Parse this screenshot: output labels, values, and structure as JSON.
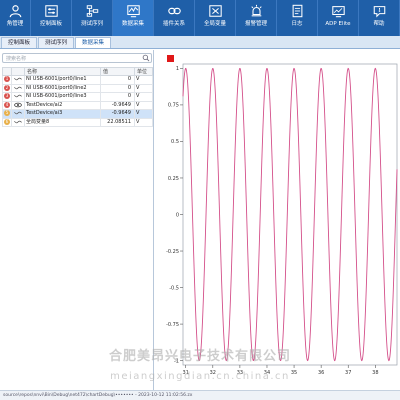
{
  "toolbar": {
    "items": [
      {
        "label": "角管理",
        "icon": "person-icon"
      },
      {
        "label": "控制面板",
        "icon": "control-panel-icon"
      },
      {
        "label": "测试序列",
        "icon": "sequence-icon"
      },
      {
        "label": "数据采集",
        "icon": "data-acquisition-icon"
      },
      {
        "label": "插件关系",
        "icon": "link-icon"
      },
      {
        "label": "全局变量",
        "icon": "global-variable-icon"
      },
      {
        "label": "报警管理",
        "icon": "alarm-icon"
      },
      {
        "label": "日志",
        "icon": "log-icon"
      },
      {
        "label": "ADP Elite",
        "icon": "adp-elite-icon"
      },
      {
        "label": "帮助",
        "icon": "help-icon"
      }
    ],
    "active_index": 3
  },
  "tabs": [
    {
      "label": "控制面板"
    },
    {
      "label": "测试序列"
    },
    {
      "label": "数据采集"
    }
  ],
  "active_tab": 2,
  "search": {
    "placeholder": "搜索名称"
  },
  "table": {
    "headers": [
      "名称",
      "值",
      "单位"
    ],
    "rows": [
      {
        "index": "1",
        "index_color": "#d9534f",
        "type": "wave",
        "name": "NI USB-6001/port0/line1",
        "value": "0",
        "unit": "V"
      },
      {
        "index": "2",
        "index_color": "#d9534f",
        "type": "wave",
        "name": "NI USB-6001/port0/line2",
        "value": "0",
        "unit": "V"
      },
      {
        "index": "3",
        "index_color": "#d9534f",
        "type": "wave",
        "name": "NI USB-6001/port0/line3",
        "value": "0",
        "unit": "V"
      },
      {
        "index": "4",
        "index_color": "#d9534f",
        "type": "eye",
        "name": "TestDevice/ai2",
        "value": "-0.9649",
        "unit": "V"
      },
      {
        "index": "5",
        "index_color": "#e8b04a",
        "type": "wave",
        "name": "TestDevice/ai3",
        "value": "-0.9649",
        "unit": "V",
        "selected": true
      },
      {
        "index": "6",
        "index_color": "#e8b04a",
        "type": "wave",
        "name": "全局变量8",
        "value": "22.08511",
        "unit": "V"
      }
    ]
  },
  "chart_data": {
    "type": "line",
    "series": [
      {
        "color": "#d4508a",
        "amplitude": 1,
        "period": 1,
        "phase_deg": 90
      }
    ],
    "xlim": [
      30.9,
      38.8
    ],
    "ylim": [
      -1.03,
      1.03
    ],
    "xticks": [
      31,
      32,
      33,
      34,
      35,
      36,
      37,
      38
    ],
    "yticks": [
      1,
      0.75,
      0.5,
      0.25,
      0,
      -0.25,
      -0.5,
      -0.75,
      -1
    ],
    "grid": false
  },
  "status": {
    "text": "source\\repos\\nnvi\\Bin\\Debug\\net472\\chartDebug\\••••••• - 2023-10-12 11:02:56.zx"
  },
  "watermark": {
    "line1": "合肥美昂兴电子技术有限公司",
    "line2": "meiangxingdian.cn.china.cn"
  },
  "colors": {
    "toolbar_bg": "#1f5fa8",
    "accent": "#2f77c8",
    "signal": "#d4508a",
    "indicator": "#e01818"
  }
}
